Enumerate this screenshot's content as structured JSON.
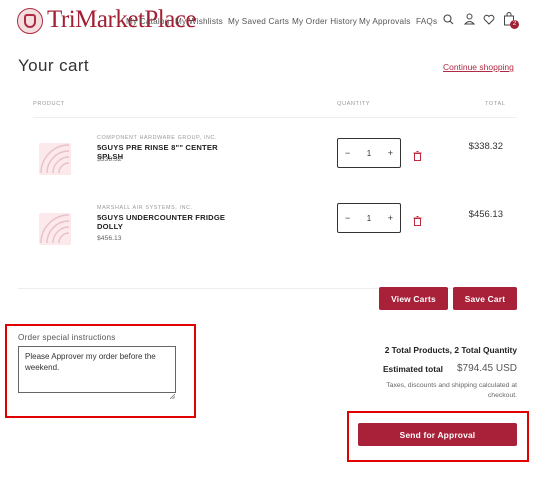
{
  "header": {
    "logo_text": "TriMarketPlace",
    "nav": [
      {
        "label": "My Catalog"
      },
      {
        "label": "My Wishlists"
      },
      {
        "label": "My Saved Carts"
      },
      {
        "label": "My Order History"
      },
      {
        "label": "My Approvals"
      },
      {
        "label": "FAQs"
      }
    ],
    "cart_count": "2"
  },
  "page": {
    "title": "Your cart",
    "continue_link": "Continue shopping"
  },
  "table": {
    "columns": {
      "product": "PRODUCT",
      "quantity": "QUANTITY",
      "total": "TOTAL"
    },
    "rows": [
      {
        "vendor": "COMPONENT HARDWARE GROUP, INC.",
        "name": "5GUYS PRE RINSE 8\"\" CENTER SPLSH",
        "price": "$338.32",
        "qty_minus": "−",
        "qty": "1",
        "qty_plus": "+",
        "total": "$338.32"
      },
      {
        "vendor": "MARSHALL AIR SYSTEMS, INC.",
        "name": "5GUYS UNDERCOUNTER FRIDGE DOLLY",
        "price": "$456.13",
        "qty_minus": "−",
        "qty": "1",
        "qty_plus": "+",
        "total": "$456.13"
      }
    ]
  },
  "actions": {
    "view_carts": "View Carts",
    "save_cart": "Save Cart",
    "send_approval": "Send for Approval"
  },
  "notes": {
    "label": "Order special instructions",
    "value": "Please Approver my order before the weekend."
  },
  "summary": {
    "totals_line": "2 Total Products, 2 Total Quantity",
    "estimated_label": "Estimated total",
    "estimated_value": "$794.45 USD",
    "tax_note": "Taxes, discounts and shipping calculated at checkout."
  },
  "colors": {
    "brand": "#a82139",
    "highlight_frame": "#e00000"
  }
}
